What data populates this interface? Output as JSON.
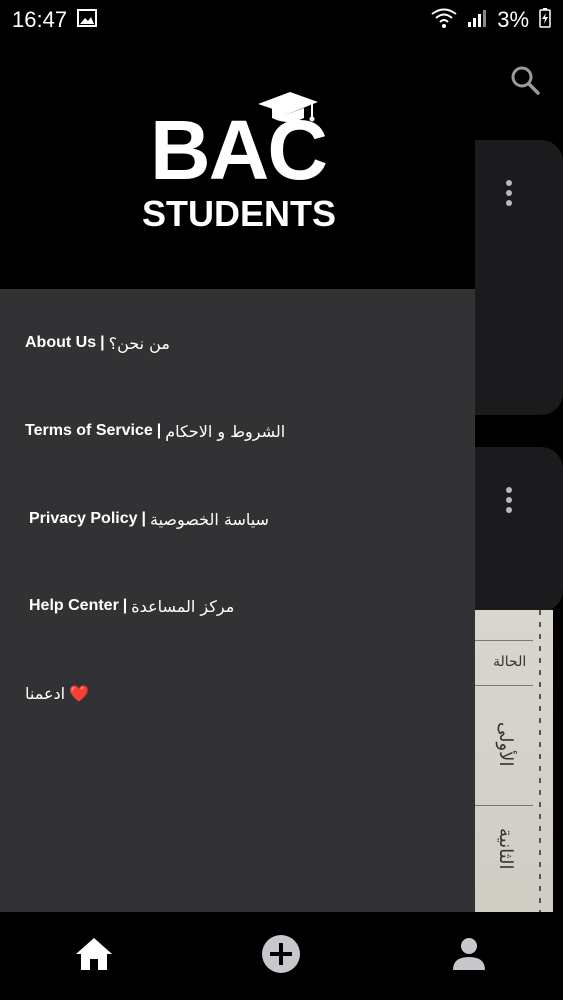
{
  "status_bar": {
    "time": "16:47",
    "battery_percent": "3%",
    "icons": [
      "image-icon",
      "wifi-icon",
      "signal-icon",
      "battery-charging-icon"
    ]
  },
  "background_screen": {
    "search_icon": "search-icon",
    "card_menu_icon": "more-vertical-icon",
    "document_text": [
      "الحالة",
      "الأولى",
      "الثانية"
    ]
  },
  "drawer": {
    "logo": {
      "line1": "BAC",
      "line2": "STUDENTS"
    },
    "items": [
      {
        "en": "About Us",
        "sep": "|",
        "ar": "من نحن؟"
      },
      {
        "en": "Terms of Service",
        "sep": "|",
        "ar": "الشروط و الاحكام"
      },
      {
        "en": "Privacy Policy",
        "sep": "|",
        "ar": "سياسة الخصوصية"
      },
      {
        "en": "Help Center",
        "sep": "|",
        "ar": "مركز المساعدة"
      },
      {
        "ar": "ادعمنا",
        "emoji": "❤️"
      }
    ]
  },
  "bottom_nav": {
    "items": [
      "home-icon",
      "add-circle-icon",
      "profile-icon"
    ]
  },
  "colors": {
    "drawer_bg": "#323234",
    "header_bg": "#000000",
    "card_bg": "#1b1b1d",
    "heart": "#e0203a"
  }
}
